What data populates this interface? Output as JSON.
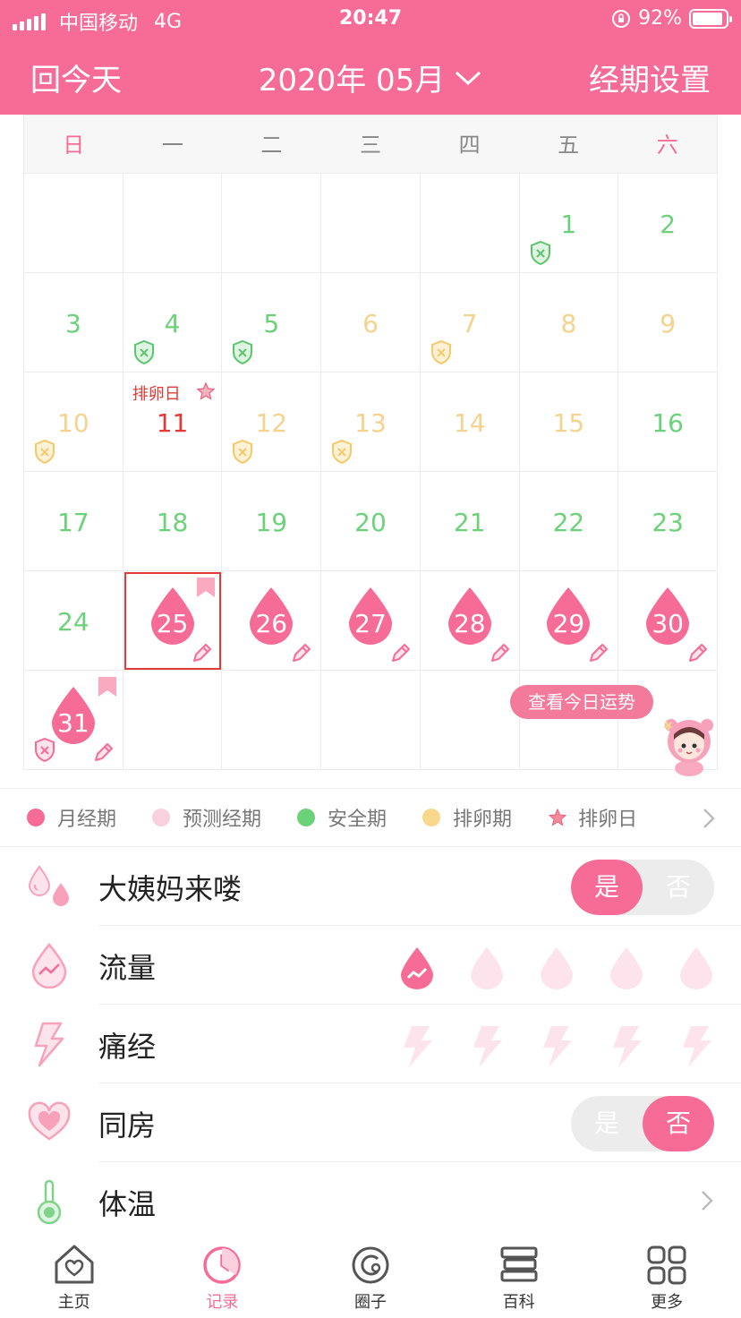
{
  "status": {
    "carrier": "中国移动",
    "network": "4G",
    "time": "20:47",
    "battery": "92%"
  },
  "header": {
    "today_button": "回今天",
    "month": "2020年 05月",
    "settings_button": "经期设置"
  },
  "weekdays": [
    "日",
    "一",
    "二",
    "三",
    "四",
    "五",
    "六"
  ],
  "calendar": {
    "ovulation_label": "排卵日",
    "days": [
      {
        "n": "",
        "k": ""
      },
      {
        "n": "",
        "k": ""
      },
      {
        "n": "",
        "k": ""
      },
      {
        "n": "",
        "k": ""
      },
      {
        "n": "",
        "k": ""
      },
      {
        "n": "1",
        "k": "safe",
        "shield": "green"
      },
      {
        "n": "2",
        "k": "safe"
      },
      {
        "n": "3",
        "k": "safe"
      },
      {
        "n": "4",
        "k": "safe",
        "shield": "green"
      },
      {
        "n": "5",
        "k": "safe",
        "shield": "green"
      },
      {
        "n": "6",
        "k": "ovul"
      },
      {
        "n": "7",
        "k": "ovul",
        "shield": "yellow"
      },
      {
        "n": "8",
        "k": "ovul"
      },
      {
        "n": "9",
        "k": "ovul"
      },
      {
        "n": "10",
        "k": "ovul",
        "shield": "yellow"
      },
      {
        "n": "11",
        "k": "ovday"
      },
      {
        "n": "12",
        "k": "ovul",
        "shield": "yellow"
      },
      {
        "n": "13",
        "k": "ovul",
        "shield": "yellow"
      },
      {
        "n": "14",
        "k": "ovul"
      },
      {
        "n": "15",
        "k": "ovul"
      },
      {
        "n": "16",
        "k": "safe"
      },
      {
        "n": "17",
        "k": "safe"
      },
      {
        "n": "18",
        "k": "safe"
      },
      {
        "n": "19",
        "k": "safe"
      },
      {
        "n": "20",
        "k": "safe"
      },
      {
        "n": "21",
        "k": "safe"
      },
      {
        "n": "22",
        "k": "safe"
      },
      {
        "n": "23",
        "k": "safe"
      },
      {
        "n": "24",
        "k": "safe"
      },
      {
        "n": "25",
        "k": "period",
        "flag": true,
        "selected": true
      },
      {
        "n": "26",
        "k": "period"
      },
      {
        "n": "27",
        "k": "period"
      },
      {
        "n": "28",
        "k": "period"
      },
      {
        "n": "29",
        "k": "period"
      },
      {
        "n": "30",
        "k": "period"
      },
      {
        "n": "31",
        "k": "period",
        "flag": true,
        "shield": "pink"
      },
      {
        "n": "",
        "k": ""
      },
      {
        "n": "",
        "k": ""
      },
      {
        "n": "",
        "k": ""
      },
      {
        "n": "",
        "k": ""
      },
      {
        "n": "",
        "k": ""
      },
      {
        "n": "",
        "k": ""
      }
    ]
  },
  "fortune_button": "查看今日运势",
  "legend": {
    "period": "月经期",
    "predicted": "预测经期",
    "safe": "安全期",
    "ovulation_period": "排卵期",
    "ovulation_day": "排卵日"
  },
  "records": {
    "period_came": {
      "label": "大姨妈来喽",
      "yes": "是",
      "no": "否",
      "value": "是"
    },
    "flow": {
      "label": "流量",
      "level": 1,
      "max": 5
    },
    "pain": {
      "label": "痛经",
      "level": 0,
      "max": 5
    },
    "intimacy": {
      "label": "同房",
      "yes": "是",
      "no": "否",
      "value": "否"
    },
    "temperature": {
      "label": "体温"
    }
  },
  "tabs": [
    {
      "label": "主页",
      "icon": "home-icon"
    },
    {
      "label": "记录",
      "icon": "clock-icon",
      "active": true
    },
    {
      "label": "圈子",
      "icon": "circle-icon"
    },
    {
      "label": "百科",
      "icon": "books-icon"
    },
    {
      "label": "更多",
      "icon": "grid-icon"
    }
  ],
  "colors": {
    "brand": "#f76c96",
    "safe": "#6cd27a",
    "ovulation": "#f5d38e",
    "ovulation_day": "#e53935",
    "predicted": "#fbd0de"
  }
}
